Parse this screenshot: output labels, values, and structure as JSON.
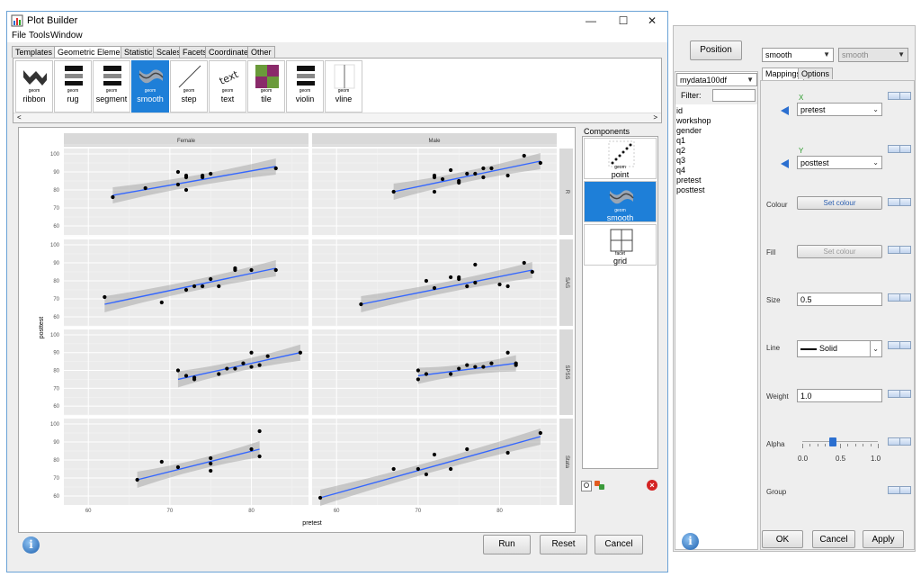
{
  "window": {
    "title": "Plot Builder",
    "controls": {
      "minimize": "—",
      "maximize": "☐",
      "close": "✕"
    }
  },
  "menu": [
    "File",
    "Tools",
    "Window"
  ],
  "tabs": [
    "Templates",
    "Geometric Elements",
    "Statistics",
    "Scales",
    "Facets",
    "Coordinates",
    "Other"
  ],
  "active_tab": "Geometric Elements",
  "palette": {
    "geom_label": "geom",
    "items": [
      {
        "name": "ribbon",
        "icon": "ribbon-icon"
      },
      {
        "name": "rug",
        "icon": "rug-icon"
      },
      {
        "name": "segment",
        "icon": "segment-icon"
      },
      {
        "name": "smooth",
        "icon": "smooth-icon",
        "selected": true
      },
      {
        "name": "step",
        "icon": "step-icon"
      },
      {
        "name": "text",
        "icon": "text-icon"
      },
      {
        "name": "tile",
        "icon": "tile-icon"
      },
      {
        "name": "violin",
        "icon": "violin-icon"
      },
      {
        "name": "vline",
        "icon": "vline-icon"
      }
    ],
    "scroll_left": "<",
    "scroll_right": ">"
  },
  "components": {
    "label": "Components",
    "items": [
      {
        "kind": "geom",
        "name": "point",
        "icon": "point-icon"
      },
      {
        "kind": "geom",
        "name": "smooth",
        "icon": "smooth-icon",
        "selected": true
      },
      {
        "kind": "facet",
        "name": "grid",
        "icon": "grid-icon"
      }
    ]
  },
  "buttons": {
    "run": "Run",
    "reset": "Reset",
    "cancel": "Cancel"
  },
  "right_panel": {
    "position_button": "Position",
    "geom_select": "smooth",
    "stat_select": "smooth",
    "dataset_select": "mydata100df",
    "filter_label": "Filter:",
    "filter_value": "",
    "variables": [
      "id",
      "workshop",
      "gender",
      "q1",
      "q2",
      "q3",
      "q4",
      "pretest",
      "posttest"
    ],
    "tabs": [
      "Mappings",
      "Options"
    ],
    "x_label": "X",
    "x_value": "pretest",
    "y_label": "Y",
    "y_value": "posttest",
    "colour_label": "Colour",
    "colour_button": "Set colour",
    "fill_label": "Fill",
    "fill_button": "Set colour",
    "size_label": "Size",
    "size_value": "0.5",
    "line_label": "Line",
    "line_value": "Solid",
    "weight_label": "Weight",
    "weight_value": "1.0",
    "alpha_label": "Alpha",
    "alpha_value": 0.4,
    "alpha_ticks": [
      "0.0",
      "0.5",
      "1.0"
    ],
    "group_label": "Group",
    "ok": "OK",
    "cancel": "Cancel",
    "apply": "Apply"
  },
  "chart_data": {
    "type": "scatter",
    "xlabel": "pretest",
    "ylabel": "posttest",
    "col_facets": [
      "Female",
      "Male"
    ],
    "row_facets": [
      "R",
      "SAS",
      "SPSS",
      "Stata"
    ],
    "xlim": [
      57,
      87
    ],
    "ylim": [
      55,
      103
    ],
    "x_ticks": [
      60,
      70,
      80
    ],
    "y_ticks": [
      60,
      70,
      80,
      90,
      100
    ],
    "smooth_color": "#3366ff",
    "panels": [
      {
        "row": "R",
        "col": "Female",
        "points": [
          [
            63,
            76
          ],
          [
            67,
            81
          ],
          [
            71,
            90
          ],
          [
            71,
            83
          ],
          [
            72,
            87
          ],
          [
            72,
            88
          ],
          [
            72,
            80
          ],
          [
            74,
            87
          ],
          [
            74,
            88
          ],
          [
            75,
            89
          ],
          [
            83,
            92
          ]
        ],
        "fit": [
          [
            63,
            77
          ],
          [
            83,
            93
          ]
        ]
      },
      {
        "row": "R",
        "col": "Male",
        "points": [
          [
            67,
            79
          ],
          [
            72,
            87
          ],
          [
            72,
            79
          ],
          [
            72,
            88
          ],
          [
            73,
            86
          ],
          [
            74,
            91
          ],
          [
            75,
            85
          ],
          [
            75,
            84
          ],
          [
            76,
            89
          ],
          [
            77,
            89
          ],
          [
            78,
            92
          ],
          [
            78,
            87
          ],
          [
            79,
            92
          ],
          [
            81,
            88
          ],
          [
            83,
            99
          ],
          [
            85,
            95
          ]
        ],
        "fit": [
          [
            67,
            79
          ],
          [
            85,
            96
          ]
        ]
      },
      {
        "row": "SAS",
        "col": "Female",
        "points": [
          [
            62,
            71
          ],
          [
            69,
            68
          ],
          [
            72,
            75
          ],
          [
            73,
            77
          ],
          [
            74,
            77
          ],
          [
            75,
            81
          ],
          [
            76,
            77
          ],
          [
            78,
            87
          ],
          [
            78,
            86
          ],
          [
            80,
            86
          ],
          [
            83,
            86
          ]
        ],
        "fit": [
          [
            62,
            67
          ],
          [
            83,
            87
          ]
        ]
      },
      {
        "row": "SAS",
        "col": "Male",
        "points": [
          [
            63,
            67
          ],
          [
            71,
            80
          ],
          [
            72,
            76
          ],
          [
            74,
            82
          ],
          [
            75,
            82
          ],
          [
            75,
            81
          ],
          [
            76,
            77
          ],
          [
            77,
            89
          ],
          [
            77,
            79
          ],
          [
            80,
            78
          ],
          [
            81,
            77
          ],
          [
            83,
            90
          ],
          [
            84,
            85
          ]
        ],
        "fit": [
          [
            63,
            67
          ],
          [
            84,
            86
          ]
        ]
      },
      {
        "row": "SPSS",
        "col": "Female",
        "points": [
          [
            71,
            80
          ],
          [
            72,
            77
          ],
          [
            73,
            76
          ],
          [
            73,
            75
          ],
          [
            76,
            78
          ],
          [
            77,
            81
          ],
          [
            78,
            81
          ],
          [
            79,
            84
          ],
          [
            80,
            90
          ],
          [
            80,
            82
          ],
          [
            81,
            83
          ],
          [
            82,
            88
          ],
          [
            86,
            90
          ]
        ],
        "fit": [
          [
            71,
            75
          ],
          [
            86,
            90
          ]
        ]
      },
      {
        "row": "SPSS",
        "col": "Male",
        "points": [
          [
            70,
            80
          ],
          [
            70,
            75
          ],
          [
            71,
            78
          ],
          [
            74,
            78
          ],
          [
            75,
            81
          ],
          [
            76,
            83
          ],
          [
            77,
            82
          ],
          [
            78,
            82
          ],
          [
            79,
            84
          ],
          [
            81,
            90
          ],
          [
            82,
            84
          ],
          [
            82,
            83
          ]
        ],
        "fit": [
          [
            70,
            77
          ],
          [
            82,
            84
          ]
        ]
      },
      {
        "row": "Stata",
        "col": "Female",
        "points": [
          [
            66,
            69
          ],
          [
            69,
            79
          ],
          [
            71,
            76
          ],
          [
            75,
            81
          ],
          [
            75,
            78
          ],
          [
            75,
            74
          ],
          [
            80,
            86
          ],
          [
            81,
            96
          ],
          [
            81,
            82
          ]
        ],
        "fit": [
          [
            66,
            69
          ],
          [
            81,
            86
          ]
        ]
      },
      {
        "row": "Stata",
        "col": "Male",
        "points": [
          [
            58,
            59
          ],
          [
            67,
            75
          ],
          [
            70,
            75
          ],
          [
            71,
            72
          ],
          [
            72,
            83
          ],
          [
            74,
            75
          ],
          [
            76,
            86
          ],
          [
            81,
            84
          ],
          [
            85,
            95
          ]
        ],
        "fit": [
          [
            58,
            59
          ],
          [
            85,
            93
          ]
        ]
      }
    ]
  }
}
